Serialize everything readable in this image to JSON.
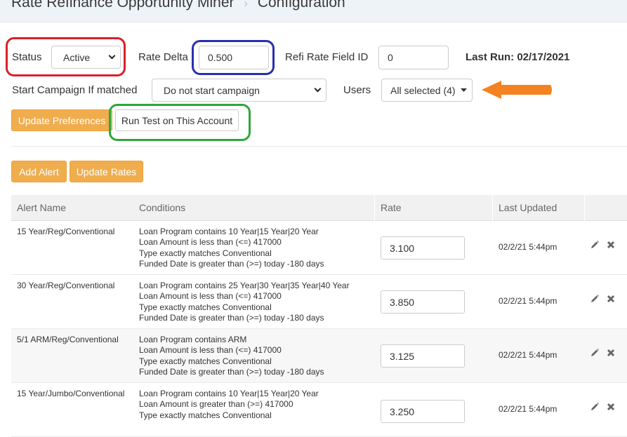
{
  "breadcrumb": {
    "parent": "Rate Refinance Opportunity Miner",
    "separator": "›",
    "current": "Configuration"
  },
  "form": {
    "status_label": "Status",
    "status_value": "Active",
    "rate_delta_label": "Rate Delta",
    "rate_delta_value": "0.500",
    "refi_field_label": "Refi Rate Field ID",
    "refi_field_value": "0",
    "last_run": "Last Run: 02/17/2021",
    "campaign_label": "Start Campaign If matched",
    "campaign_value": "Do not start campaign",
    "users_label": "Users",
    "users_value": "All selected (4)"
  },
  "buttons": {
    "update_preferences": "Update Preferences",
    "run_test": "Run Test on This Account",
    "add_alert": "Add Alert",
    "update_rates": "Update Rates"
  },
  "table": {
    "headers": {
      "alert_name": "Alert Name",
      "conditions": "Conditions",
      "rate": "Rate",
      "last_updated": "Last Updated"
    },
    "rows": [
      {
        "name": "15 Year/Reg/Conventional",
        "conditions": [
          "Loan Program contains 10 Year|15 Year|20 Year",
          "Loan Amount is less than (<=) 417000",
          "Type exactly matches Conventional",
          "Funded Date is greater than (>=) today -180 days"
        ],
        "rate": "3.100",
        "updated": "02/2/21 5:44pm"
      },
      {
        "name": "30 Year/Reg/Conventional",
        "conditions": [
          "Loan Program contains 25 Year|30 Year|35 Year|40 Year",
          "Loan Amount is less than (<=) 417000",
          "Type exactly matches Conventional",
          "Funded Date is greater than (>=) today -180 days"
        ],
        "rate": "3.850",
        "updated": "02/2/21 5:44pm"
      },
      {
        "name": "5/1 ARM/Reg/Conventional",
        "conditions": [
          "Loan Program contains ARM",
          "Loan Amount is less than (<=) 417000",
          "Type exactly matches Conventional",
          "Funded Date is greater than (>=) today -180 days"
        ],
        "rate": "3.125",
        "updated": "02/2/21 5:44pm"
      },
      {
        "name": "15 Year/Jumbo/Conventional",
        "conditions": [
          "Loan Program contains 10 Year|15 Year|20 Year",
          "Loan Amount is greater than (>=) 417000",
          "Type exactly matches Conventional",
          ""
        ],
        "rate": "3.250",
        "updated": "02/2/21 5:44pm"
      }
    ]
  },
  "annotations": {
    "status_ring_color": "#d9202a",
    "rate_delta_ring_color": "#2b2fb0",
    "run_test_ring_color": "#2ca83a",
    "arrow_color": "#f58220"
  },
  "colors": {
    "primary_button": "#f0ad4e"
  }
}
